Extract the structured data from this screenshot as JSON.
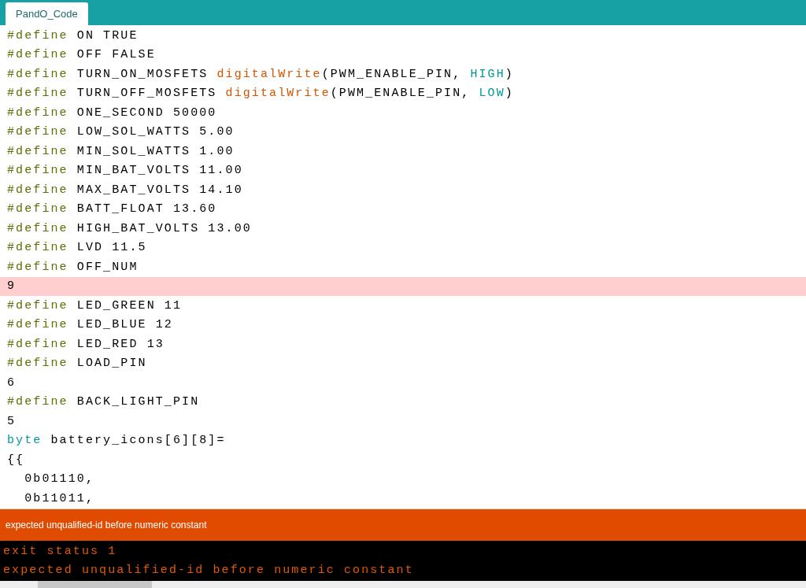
{
  "tabs": [
    {
      "label": "PandO_Code",
      "selected": true
    }
  ],
  "editor": {
    "lines": [
      {
        "highlighted": false,
        "tokens": [
          {
            "kind": "directive",
            "text": "#define"
          },
          {
            "kind": "plain",
            "text": " ON TRUE"
          }
        ]
      },
      {
        "highlighted": false,
        "tokens": [
          {
            "kind": "directive",
            "text": "#define"
          },
          {
            "kind": "plain",
            "text": " OFF FALSE"
          }
        ]
      },
      {
        "highlighted": false,
        "tokens": [
          {
            "kind": "directive",
            "text": "#define"
          },
          {
            "kind": "plain",
            "text": " TURN_ON_MOSFETS "
          },
          {
            "kind": "function",
            "text": "digitalWrite"
          },
          {
            "kind": "plain",
            "text": "(PWM_ENABLE_PIN, "
          },
          {
            "kind": "constant",
            "text": "HIGH"
          },
          {
            "kind": "plain",
            "text": ")"
          }
        ]
      },
      {
        "highlighted": false,
        "tokens": [
          {
            "kind": "directive",
            "text": "#define"
          },
          {
            "kind": "plain",
            "text": " TURN_OFF_MOSFETS "
          },
          {
            "kind": "function",
            "text": "digitalWrite"
          },
          {
            "kind": "plain",
            "text": "(PWM_ENABLE_PIN, "
          },
          {
            "kind": "constant",
            "text": "LOW"
          },
          {
            "kind": "plain",
            "text": ")"
          }
        ]
      },
      {
        "highlighted": false,
        "tokens": [
          {
            "kind": "directive",
            "text": "#define"
          },
          {
            "kind": "plain",
            "text": " ONE_SECOND 50000"
          }
        ]
      },
      {
        "highlighted": false,
        "tokens": [
          {
            "kind": "directive",
            "text": "#define"
          },
          {
            "kind": "plain",
            "text": " LOW_SOL_WATTS 5.00"
          }
        ]
      },
      {
        "highlighted": false,
        "tokens": [
          {
            "kind": "directive",
            "text": "#define"
          },
          {
            "kind": "plain",
            "text": " MIN_SOL_WATTS 1.00"
          }
        ]
      },
      {
        "highlighted": false,
        "tokens": [
          {
            "kind": "directive",
            "text": "#define"
          },
          {
            "kind": "plain",
            "text": " MIN_BAT_VOLTS 11.00"
          }
        ]
      },
      {
        "highlighted": false,
        "tokens": [
          {
            "kind": "directive",
            "text": "#define"
          },
          {
            "kind": "plain",
            "text": " MAX_BAT_VOLTS 14.10"
          }
        ]
      },
      {
        "highlighted": false,
        "tokens": [
          {
            "kind": "directive",
            "text": "#define"
          },
          {
            "kind": "plain",
            "text": " BATT_FLOAT 13.60"
          }
        ]
      },
      {
        "highlighted": false,
        "tokens": [
          {
            "kind": "directive",
            "text": "#define"
          },
          {
            "kind": "plain",
            "text": " HIGH_BAT_VOLTS 13.00"
          }
        ]
      },
      {
        "highlighted": false,
        "tokens": [
          {
            "kind": "directive",
            "text": "#define"
          },
          {
            "kind": "plain",
            "text": " LVD 11.5"
          }
        ]
      },
      {
        "highlighted": false,
        "tokens": [
          {
            "kind": "directive",
            "text": "#define"
          },
          {
            "kind": "plain",
            "text": " OFF_NUM"
          }
        ]
      },
      {
        "highlighted": true,
        "tokens": [
          {
            "kind": "plain",
            "text": "9"
          }
        ]
      },
      {
        "highlighted": false,
        "tokens": [
          {
            "kind": "directive",
            "text": "#define"
          },
          {
            "kind": "plain",
            "text": " LED_GREEN 11"
          }
        ]
      },
      {
        "highlighted": false,
        "tokens": [
          {
            "kind": "directive",
            "text": "#define"
          },
          {
            "kind": "plain",
            "text": " LED_BLUE 12"
          }
        ]
      },
      {
        "highlighted": false,
        "tokens": [
          {
            "kind": "directive",
            "text": "#define"
          },
          {
            "kind": "plain",
            "text": " LED_RED 13"
          }
        ]
      },
      {
        "highlighted": false,
        "tokens": [
          {
            "kind": "directive",
            "text": "#define"
          },
          {
            "kind": "plain",
            "text": " LOAD_PIN"
          }
        ]
      },
      {
        "highlighted": false,
        "tokens": [
          {
            "kind": "plain",
            "text": "6"
          }
        ]
      },
      {
        "highlighted": false,
        "tokens": [
          {
            "kind": "directive",
            "text": "#define"
          },
          {
            "kind": "plain",
            "text": " BACK_LIGHT_PIN"
          }
        ]
      },
      {
        "highlighted": false,
        "tokens": [
          {
            "kind": "plain",
            "text": "5"
          }
        ]
      },
      {
        "highlighted": false,
        "tokens": [
          {
            "kind": "keyword",
            "text": "byte"
          },
          {
            "kind": "plain",
            "text": " battery_icons[6][8]="
          }
        ]
      },
      {
        "highlighted": false,
        "tokens": [
          {
            "kind": "plain",
            "text": "{{"
          }
        ]
      },
      {
        "highlighted": false,
        "tokens": [
          {
            "kind": "plain",
            "text": "  0b01110,"
          }
        ]
      },
      {
        "highlighted": false,
        "tokens": [
          {
            "kind": "plain",
            "text": "  0b11011,"
          }
        ]
      }
    ]
  },
  "status_bar": {
    "message": "expected unqualified-id before numeric constant"
  },
  "console": {
    "lines": [
      "exit status 1",
      "expected unqualified-id before numeric constant"
    ]
  }
}
